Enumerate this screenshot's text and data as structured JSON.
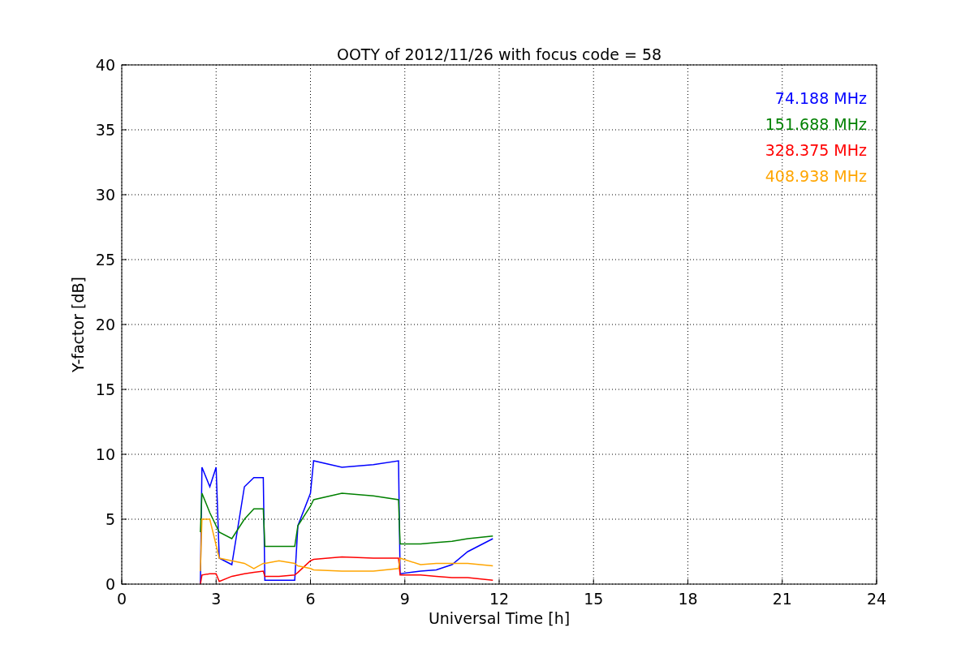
{
  "chart_data": {
    "type": "line",
    "title": "OOTY of 2012/11/26 with focus code = 58",
    "xlabel": "Universal Time [h]",
    "ylabel": "Y-factor [dB]",
    "x": [
      2.5,
      2.55,
      2.8,
      3.0,
      3.1,
      3.5,
      3.9,
      4.2,
      4.5,
      4.55,
      5.0,
      5.5,
      5.6,
      6.0,
      6.1,
      7.0,
      8.0,
      8.8,
      8.85,
      9.5,
      10.0,
      10.5,
      11.0,
      11.8
    ],
    "series": [
      {
        "name": "74.188 MHz",
        "color": "#0000ff",
        "values": [
          0,
          9,
          7.5,
          9,
          2,
          1.5,
          7.5,
          8.2,
          8.2,
          0.3,
          0.3,
          0.3,
          4.5,
          7,
          9.5,
          9,
          9.2,
          9.5,
          0.8,
          1.0,
          1.1,
          1.5,
          2.5,
          3.5
        ]
      },
      {
        "name": "151.688 MHz",
        "color": "#008000",
        "values": [
          4,
          7,
          5.5,
          4.5,
          4,
          3.5,
          5,
          5.8,
          5.8,
          2.9,
          2.9,
          2.9,
          4.5,
          6,
          6.5,
          7,
          6.8,
          6.5,
          3.1,
          3.1,
          3.2,
          3.3,
          3.5,
          3.7
        ]
      },
      {
        "name": "328.375 MHz",
        "color": "#ff0000",
        "values": [
          0,
          0.7,
          0.8,
          0.8,
          0.2,
          0.6,
          0.8,
          0.9,
          1,
          0.6,
          0.6,
          0.7,
          0.9,
          1.8,
          1.9,
          2.1,
          2,
          2,
          0.7,
          0.7,
          0.6,
          0.5,
          0.5,
          0.3
        ]
      },
      {
        "name": "408.938 MHz",
        "color": "#ffa500",
        "values": [
          1,
          5,
          5,
          3,
          2,
          1.8,
          1.6,
          1.2,
          1.6,
          1.6,
          1.8,
          1.6,
          1.4,
          1.2,
          1.1,
          1,
          1,
          1.2,
          2,
          1.5,
          1.6,
          1.6,
          1.6,
          1.4
        ]
      }
    ],
    "xlim": [
      0,
      24
    ],
    "ylim": [
      0,
      40
    ],
    "xticks": [
      0,
      3,
      6,
      9,
      12,
      15,
      18,
      21,
      24
    ],
    "yticks": [
      0,
      5,
      10,
      15,
      20,
      25,
      30,
      35,
      40
    ],
    "grid": true
  }
}
